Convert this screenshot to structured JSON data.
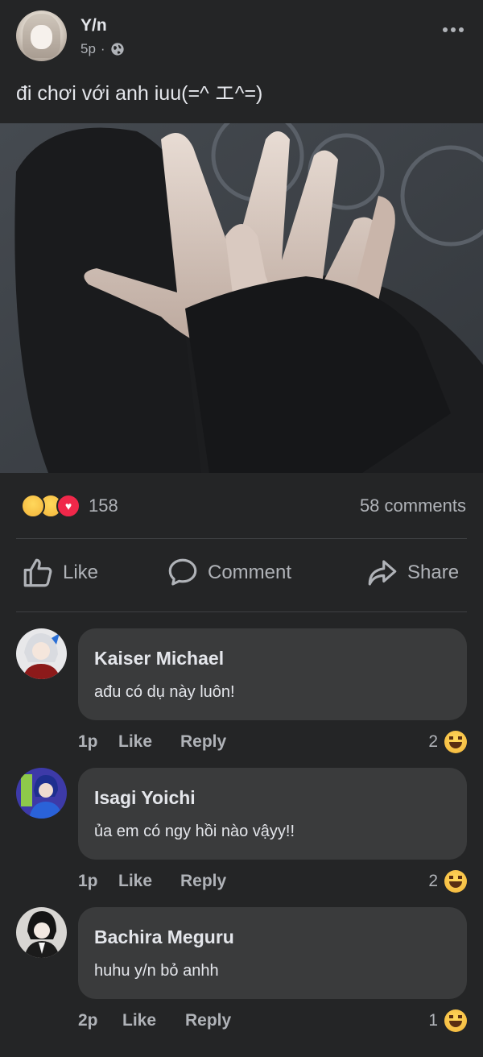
{
  "post": {
    "author": "Y/n",
    "time": "5p",
    "separator": "·",
    "caption": "đi chơi với anh iuu(=^ エ^=)",
    "photo": "hands-photo",
    "reactions": {
      "icons": [
        "wow-icon",
        "sad-icon",
        "love-icon"
      ],
      "count": "158",
      "comments": "58 comments"
    },
    "actions": {
      "like": "Like",
      "comment": "Comment",
      "share": "Share"
    }
  },
  "comments": [
    {
      "name": "Kaiser Michael",
      "text": "ađu có dụ này luôn!",
      "time": "1p",
      "like": "Like",
      "reply": "Reply",
      "reaction_count": "2"
    },
    {
      "name": "Isagi Yoichi",
      "text": "ủa em có ngy hồi nào vậyy!!",
      "time": "1p",
      "like": "Like",
      "reply": "Reply",
      "reaction_count": "2"
    },
    {
      "name": "Bachira Meguru",
      "text": "huhu y/n bỏ anhh",
      "time": "2p",
      "like": "Like",
      "reply": "Reply",
      "reaction_count": "1"
    }
  ],
  "colors": {
    "background": "#242526",
    "bubble": "#3a3b3c",
    "text": "#e4e6eb",
    "muted": "#b0b3b8",
    "love": "#f0284a"
  }
}
